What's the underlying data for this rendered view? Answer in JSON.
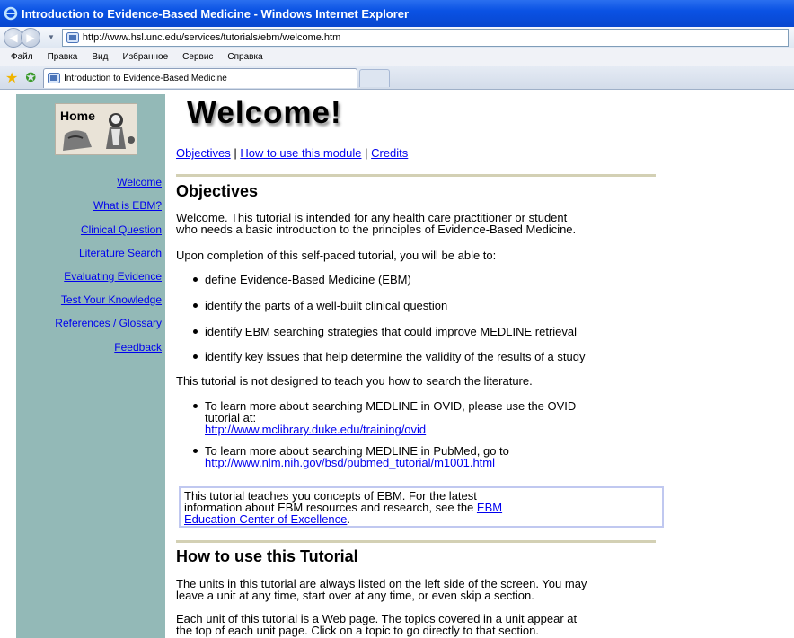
{
  "window": {
    "title": "Introduction to Evidence-Based Medicine - Windows Internet Explorer",
    "address_url": "http://www.hsl.unc.edu/services/tutorials/ebm/welcome.htm",
    "back_icon": "back-arrow-icon",
    "forward_icon": "forward-arrow-icon"
  },
  "menu": {
    "items": [
      "Файл",
      "Правка",
      "Вид",
      "Избранное",
      "Сервис",
      "Справка"
    ]
  },
  "tabs": {
    "active_tab_label": "Introduction to Evidence-Based Medicine"
  },
  "sidebar": {
    "home_label": "Home",
    "items": [
      {
        "label": "Welcome"
      },
      {
        "label": "What is EBM?"
      },
      {
        "label": "Clinical Question"
      },
      {
        "label": "Literature Search"
      },
      {
        "label": "Evaluating Evidence"
      },
      {
        "label": "Test Your Knowledge"
      },
      {
        "label": "References / Glossary"
      },
      {
        "label": "Feedback"
      }
    ]
  },
  "main": {
    "heading": "Welcome!",
    "toplinks": {
      "objectives": "Objectives",
      "how_to_use": "How to use this module",
      "credits": "Credits",
      "separator": "|"
    },
    "objectives_heading": "Objectives",
    "intro_line1": "Welcome. This tutorial is intended for any health care practitioner or student",
    "intro_line2": "who needs a basic introduction to the principles of Evidence-Based Medicine.",
    "completion_text": "Upon completion of this self-paced tutorial, you will be able to:",
    "objectives_list": [
      "define Evidence-Based Medicine (EBM)",
      "identify the parts of a well-built clinical question",
      "identify EBM searching strategies that could improve MEDLINE retrieval",
      "identify key issues that help determine the validity of the results of a study"
    ],
    "not_designed_text": "This tutorial is not designed to teach you how to search the literature.",
    "ovid_line1": "To learn more about searching MEDLINE in OVID, please use the OVID",
    "ovid_line2": "tutorial at:",
    "ovid_link": "http://www.mclibrary.duke.edu/training/ovid",
    "pubmed_line1": "To learn more about searching MEDLINE in PubMed, go to",
    "pubmed_link": "http://www.nlm.nih.gov/bsd/pubmed_tutorial/m1001.html",
    "callout_line1": "This tutorial teaches you concepts of EBM. For the latest",
    "callout_line2_prefix": "information about EBM resources and research, see the",
    "callout_link_part1": "EBM",
    "callout_link_part2": "Education Center of Excellence",
    "callout_suffix": ".",
    "howto_heading": "How to use this Tutorial",
    "howto_p1_line1": "The units in this tutorial are always listed on the left side of the screen. You may",
    "howto_p1_line2": "leave a unit at any time, start over at any time, or even skip a section.",
    "howto_p2_line1": "Each unit of this tutorial is a Web page. The topics covered in a unit appear at",
    "howto_p2_line2": "the top of each unit page. Click on a topic to go directly to that section."
  }
}
